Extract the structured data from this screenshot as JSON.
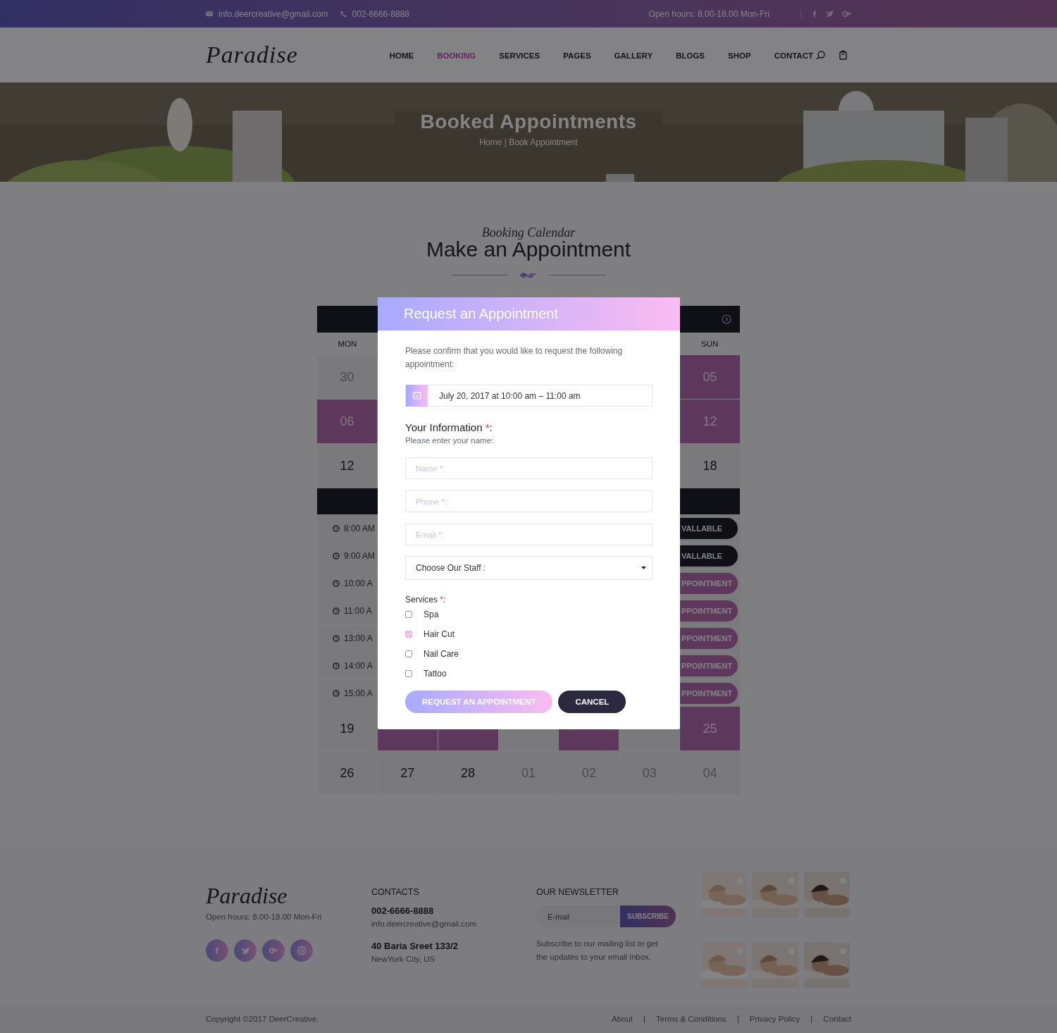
{
  "top_bar": {
    "email": "info.deercreative@gmail.com",
    "phone": "002-6666-8888",
    "hours": "Open hours: 8.00-18.00 Mon-Fri"
  },
  "nav": {
    "logo": "Paradise",
    "items": [
      {
        "label": "HOME",
        "selected": false
      },
      {
        "label": "BOOKING",
        "selected": true
      },
      {
        "label": "SERVICES",
        "selected": false
      },
      {
        "label": "PAGES",
        "selected": false
      },
      {
        "label": "GALLERY",
        "selected": false
      },
      {
        "label": "BLOGS",
        "selected": false
      },
      {
        "label": "SHOP",
        "selected": false
      },
      {
        "label": "CONTACT",
        "selected": false
      }
    ]
  },
  "hero": {
    "title": "Booked Appointments",
    "breadcrumb": "Home | Book Appointment"
  },
  "section": {
    "script_title": "Booking Calendar",
    "title": "Make an Appointment"
  },
  "calendar": {
    "weekdays": {
      "first": "MON",
      "last": "SUN"
    },
    "blocks": [
      {
        "kind": "edge_week",
        "cells": [
          {
            "day": "30",
            "kind": "muted"
          },
          {
            "day": "05",
            "kind": "booked"
          }
        ]
      },
      {
        "kind": "edge_week",
        "cells": [
          {
            "day": "06",
            "kind": "booked"
          },
          {
            "day": "12",
            "kind": "booked"
          }
        ]
      },
      {
        "kind": "edge_week",
        "cells": [
          {
            "day": "12",
            "kind": "open"
          },
          {
            "day": "18",
            "kind": "open"
          }
        ]
      },
      {
        "kind": "slots",
        "slots": [
          {
            "time": "8:00 AM",
            "status": "VALLABLE",
            "kind": "unavailable"
          },
          {
            "time": "9:00 AM",
            "status": "VALLABLE",
            "kind": "unavailable"
          },
          {
            "time": "10:00 A",
            "status": "PPOINTMENT",
            "kind": "bookable"
          },
          {
            "time": "11:00 A",
            "status": "PPOINTMENT",
            "kind": "bookable"
          },
          {
            "time": "13:00 A",
            "status": "PPOINTMENT",
            "kind": "bookable"
          },
          {
            "time": "14:00 A",
            "status": "PPOINTMENT",
            "kind": "bookable"
          },
          {
            "time": "15:00 A",
            "status": "PPOINTMENT",
            "kind": "bookable"
          }
        ]
      },
      {
        "kind": "week",
        "cells": [
          {
            "day": "19",
            "kind": "open"
          },
          {
            "kind": "booked"
          },
          {
            "kind": "booked"
          },
          {
            "kind": "open"
          },
          {
            "kind": "booked"
          },
          {
            "kind": "open"
          },
          {
            "day": "25",
            "kind": "booked"
          }
        ]
      },
      {
        "kind": "week",
        "cells": [
          {
            "day": "26",
            "kind": "open"
          },
          {
            "day": "27",
            "kind": "open"
          },
          {
            "day": "28",
            "kind": "open"
          },
          {
            "day": "01",
            "kind": "muted"
          },
          {
            "day": "02",
            "kind": "muted"
          },
          {
            "day": "03",
            "kind": "muted"
          },
          {
            "day": "04",
            "kind": "muted"
          }
        ]
      }
    ]
  },
  "modal": {
    "title": "Request an Appointment",
    "intro": "Please confirm that you would like to request the following appointment:",
    "appointment": "July 20, 2017 at 10:00 am – 11:00 am",
    "info_heading": {
      "text": "Your Information",
      "required_mark": "*",
      "suffix": ":"
    },
    "hint": "Please enter your name:",
    "fields": [
      {
        "placeholder": "Name *:"
      },
      {
        "placeholder": "Phone *:"
      },
      {
        "placeholder": "Email *:"
      }
    ],
    "staff_select": "Choose Our Staff :",
    "services_label": {
      "text": "Services",
      "required_mark": "*",
      "suffix": ":"
    },
    "services": [
      {
        "label": "Spa",
        "checked": false
      },
      {
        "label": "Hair Cut",
        "checked": true
      },
      {
        "label": "Nail Care",
        "checked": false
      },
      {
        "label": "Tattoo",
        "checked": false
      }
    ],
    "primary_button": "REQUEST AN APPOINTMENT",
    "cancel_button": "CANCEL"
  },
  "footer": {
    "logo": "Paradise",
    "hours": "Open hours: 8.00-18.00 Mon-Fri",
    "contacts": {
      "heading": "CONTACTS",
      "phone": "002-6666-8888",
      "email": "info.deercreative@gmail.com",
      "address": "40 Baria Sreet 133/2",
      "city": "NewYork City, US"
    },
    "newsletter": {
      "heading": "OUR NEWSLETTER",
      "placeholder": "E-mail",
      "button": "SUBSCRIBE",
      "text": "Subscribe to our mailing list to get the updates to your email inbox."
    },
    "copyright": "Copyright ©2017 DeerCreative.",
    "links": [
      "About",
      "Terms & Conditions",
      "Privacy Policy",
      "Contact"
    ]
  }
}
